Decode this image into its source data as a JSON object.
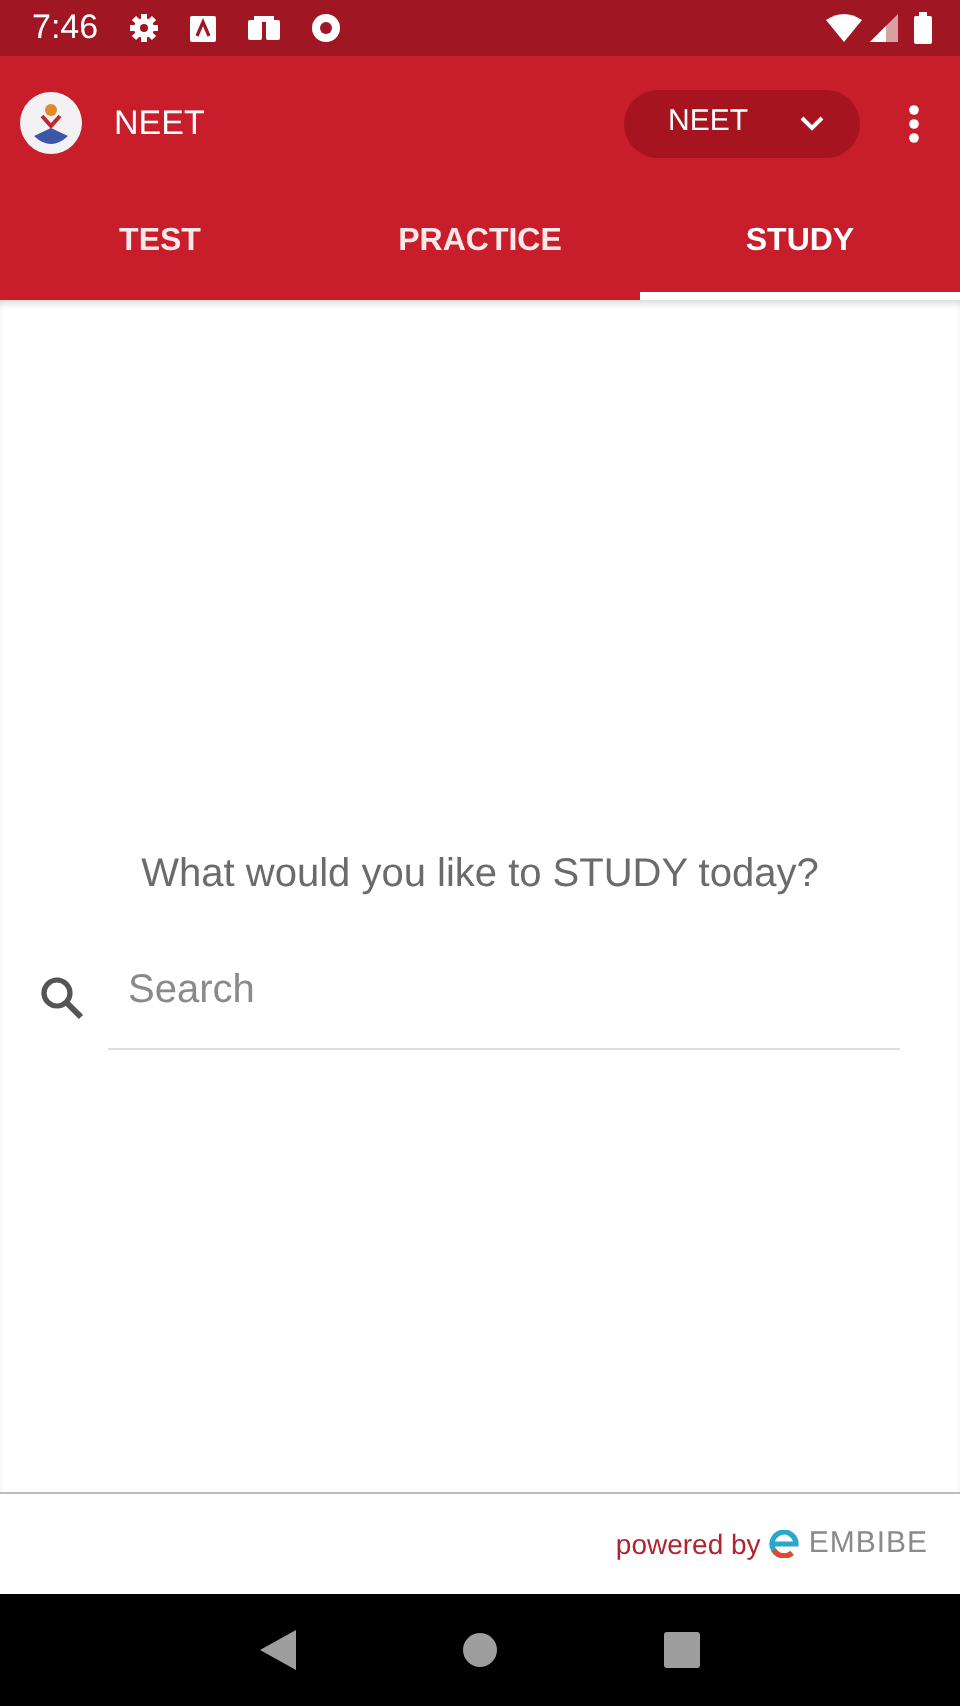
{
  "status_bar": {
    "time": "7:46"
  },
  "app_bar": {
    "title": "NEET",
    "selector": {
      "value": "NEET"
    }
  },
  "tabs": [
    {
      "label": "TEST",
      "selected": false
    },
    {
      "label": "PRACTICE",
      "selected": false
    },
    {
      "label": "STUDY",
      "selected": true
    }
  ],
  "content": {
    "prompt": "What would you like to STUDY today?",
    "search": {
      "placeholder": "Search"
    }
  },
  "footer": {
    "powered_by": "powered by",
    "brand": "EMBIBE"
  }
}
